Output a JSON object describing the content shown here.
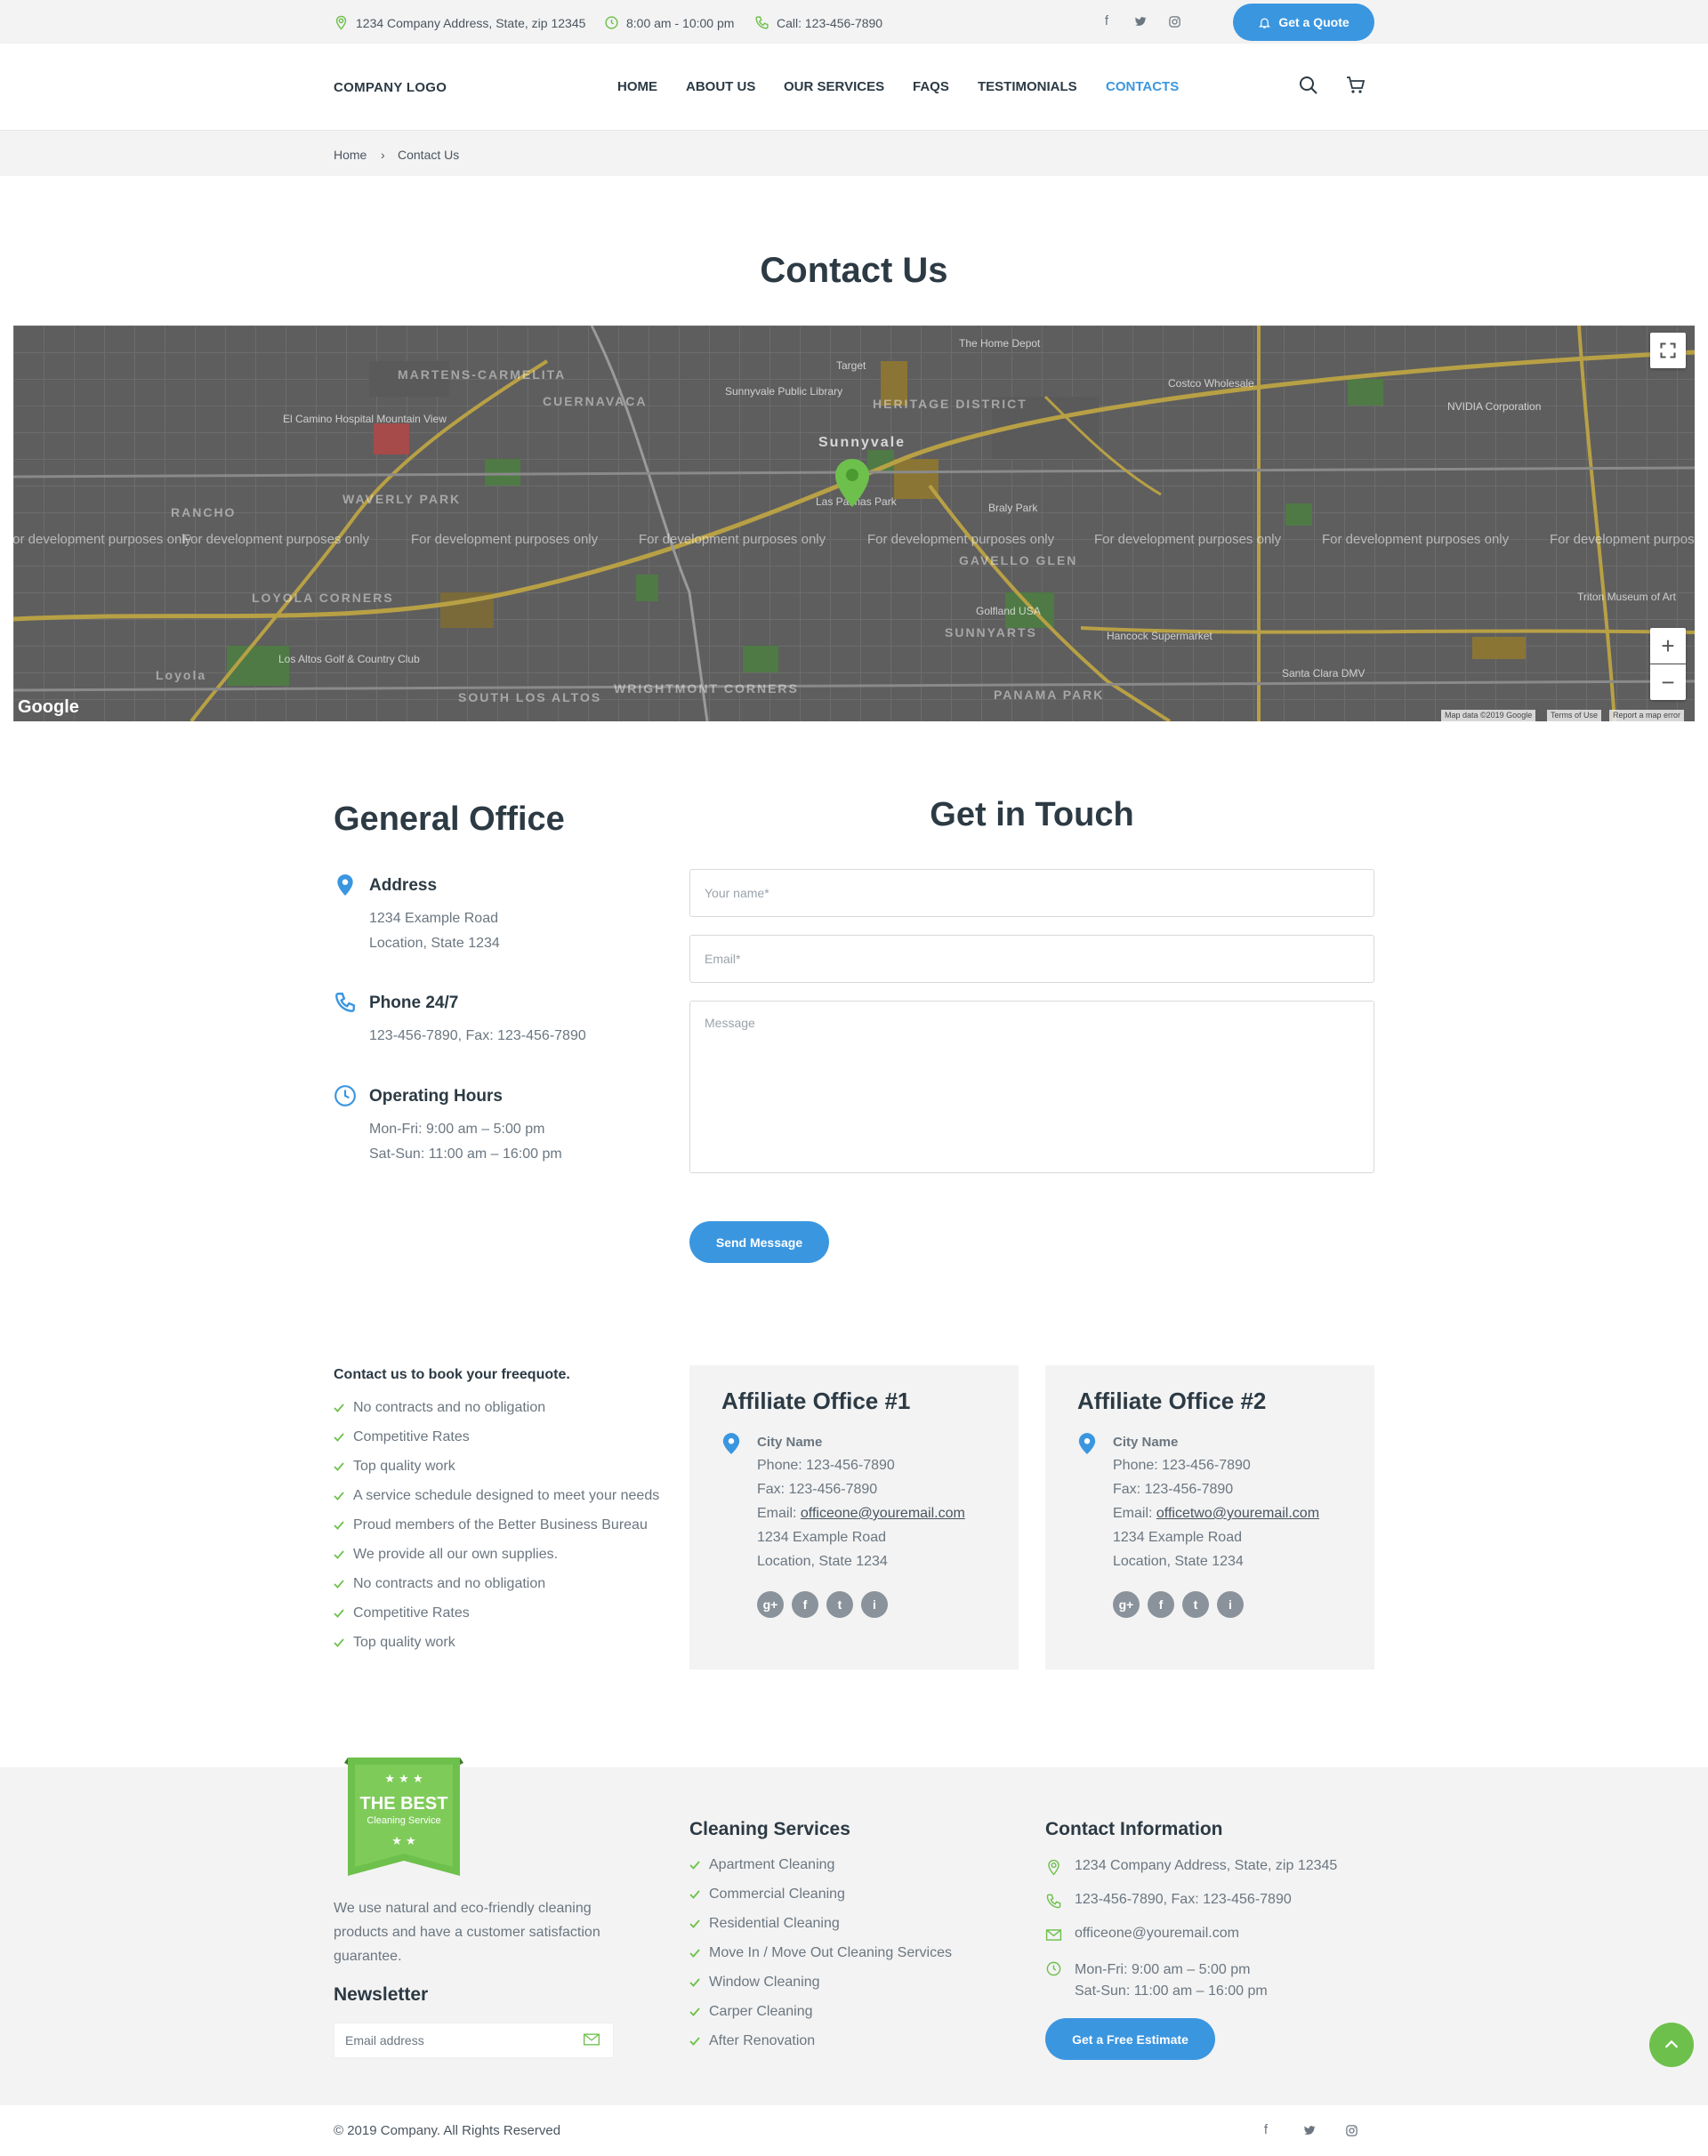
{
  "colors": {
    "accent": "#3b96e0",
    "green": "#6ec04c",
    "text_dark": "#2c3a44",
    "text_muted": "#6b7680",
    "panel_bg": "#f3f3f3"
  },
  "topbar": {
    "address": "1234 Company Address, State, zip 12345",
    "hours": "8:00 am - 10:00 pm",
    "phone": "Call: 123-456-7890",
    "social_icons": [
      "facebook-icon",
      "twitter-icon",
      "instagram-icon"
    ],
    "quote_label": "Get a Quote"
  },
  "header": {
    "logo": "COMPANY LOGO",
    "nav": [
      "HOME",
      "ABOUT US",
      "OUR SERVICES",
      "FAQS",
      "TESTIMONIALS",
      "CONTACTS"
    ],
    "active_nav": "CONTACTS",
    "icons": [
      "search-icon",
      "cart-icon"
    ]
  },
  "breadcrumb": {
    "home": "Home",
    "separator": "›",
    "current": "Contact Us"
  },
  "page_title": "Contact Us",
  "map": {
    "watermark": "For development purposes only",
    "districts": [
      "MARTENS-CARMELITA",
      "CUERNAVACA",
      "HERITAGE DISTRICT",
      "WAVERLY PARK",
      "RANCHO",
      "LOYOLA CORNERS",
      "SUNNYARTS",
      "PANAMA PARK",
      "WRIGHTMONT CORNERS",
      "SOUTH LOS ALTOS",
      "GAVELLO GLEN"
    ],
    "pois": [
      "The Home Depot",
      "Target",
      "Sunnyvale Public Library",
      "Costco Wholesale",
      "NVIDIA Corporation",
      "El Camino Hospital Mountain View",
      "Braly Park",
      "Golfland USA",
      "Hancock Supermarket",
      "Santa Clara DMV",
      "Los Altos Golf & Country Club",
      "Triton Museum of Art",
      "Sunnyvale",
      "Las Palmas Park",
      "Loyola"
    ],
    "logo": "Google",
    "footer": [
      "Map data ©2019 Google",
      "Terms of Use",
      "Report a map error"
    ],
    "controls": [
      "fullscreen-icon",
      "zoom-in-icon",
      "zoom-out-icon"
    ]
  },
  "general_office": {
    "title": "General Office",
    "address_label": "Address",
    "address_lines": [
      "1234 Example Road",
      "Location, State 1234"
    ],
    "phone_label": "Phone 24/7",
    "phone_line": "123-456-7890, Fax: 123-456-7890",
    "hours_label": "Operating Hours",
    "hours_lines": [
      "Mon-Fri: 9:00 am – 5:00 pm",
      "Sat-Sun: 11:00 am – 16:00 pm"
    ]
  },
  "contact_form": {
    "title": "Get in Touch",
    "name_placeholder": "Your name*",
    "email_placeholder": "Email*",
    "message_placeholder": "Message",
    "submit_label": "Send Message"
  },
  "book_quote": {
    "title": "Contact us to book your freequote.",
    "items": [
      "No contracts and no obligation",
      "Competitive Rates",
      "Top quality work",
      "A service schedule designed to meet your needs",
      "Proud members of the Better Business Bureau",
      "We provide all our own supplies.",
      "No contracts and no obligation",
      "Competitive Rates",
      "Top quality work"
    ]
  },
  "affiliates": [
    {
      "title": "Affiliate Office #1",
      "city": "City Name",
      "phone": "Phone: 123-456-7890",
      "fax": "Fax: 123-456-7890",
      "email_label": "Email: ",
      "email": "officeone@youremail.com",
      "address_lines": [
        "1234 Example Road",
        "Location, State 1234"
      ],
      "social": [
        "g+",
        "f",
        "t",
        "i"
      ]
    },
    {
      "title": "Affiliate Office #2",
      "city": "City Name",
      "phone": "Phone: 123-456-7890",
      "fax": "Fax: 123-456-7890",
      "email_label": "Email: ",
      "email": "officetwo@youremail.com",
      "address_lines": [
        "1234 Example Road",
        "Location, State 1234"
      ],
      "social": [
        "g+",
        "f",
        "t",
        "i"
      ]
    }
  ],
  "footer": {
    "badge": {
      "line1": "THE BEST",
      "line2": "Cleaning Service"
    },
    "about": "We use natural and eco-friendly cleaning products and have a customer satisfaction guarantee.",
    "newsletter_title": "Newsletter",
    "newsletter_placeholder": "Email address",
    "services_title": "Cleaning Services",
    "services": [
      "Apartment Cleaning",
      "Commercial Cleaning",
      "Residential Cleaning",
      "Move In / Move Out Cleaning Services",
      "Window Cleaning",
      "Carper Cleaning",
      "After Renovation"
    ],
    "contact_title": "Contact Information",
    "contact_address": "1234 Company Address, State, zip 12345",
    "contact_phone": "123-456-7890, Fax: 123-456-7890",
    "contact_email": "officeone@youremail.com",
    "contact_hours": [
      "Mon-Fri: 9:00 am – 5:00 pm",
      "Sat-Sun: 11:00 am – 16:00 pm"
    ],
    "estimate_label": "Get a Free Estimate",
    "copyright": "© 2019 Company. All Rights Reserved",
    "bottom_social": [
      "facebook-icon",
      "twitter-icon",
      "instagram-icon"
    ]
  }
}
